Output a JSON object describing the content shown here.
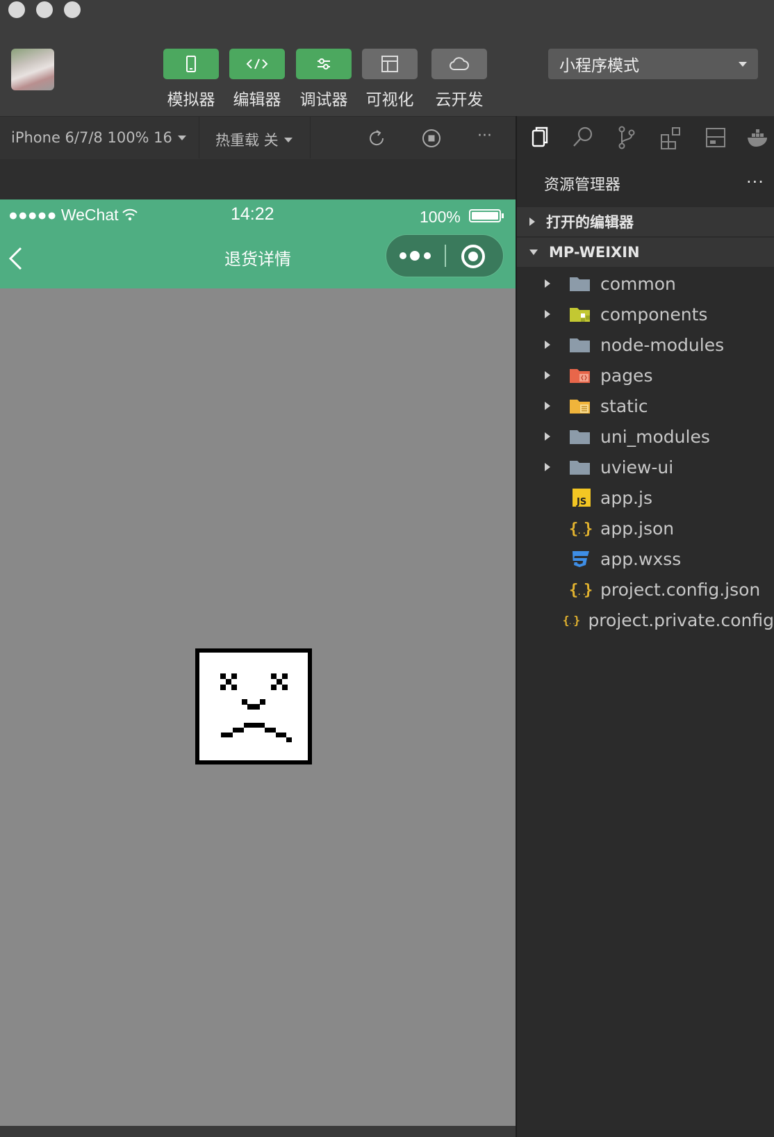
{
  "toolbar": {
    "buttons": [
      {
        "label": "模拟器",
        "icon": "phone-icon"
      },
      {
        "label": "编辑器",
        "icon": "code-icon"
      },
      {
        "label": "调试器",
        "icon": "sliders-icon"
      },
      {
        "label": "可视化",
        "icon": "layout-icon"
      },
      {
        "label": "云开发",
        "icon": "cloud-icon"
      }
    ],
    "mode_select": "小程序模式"
  },
  "simulator": {
    "device": "iPhone 6/7/8 100% 16",
    "hot_reload": "热重载 关",
    "more": "···"
  },
  "phone": {
    "carrier": "●●●●● WeChat",
    "time": "14:22",
    "battery": "100%",
    "nav_title": "退货详情"
  },
  "explorer": {
    "title": "资源管理器",
    "more": "···",
    "sections": {
      "open_editors": "打开的编辑器",
      "project": "MP-WEIXIN"
    },
    "items": [
      {
        "name": "common",
        "folder": true,
        "icon": "folder-icon"
      },
      {
        "name": "components",
        "folder": true,
        "icon": "components-folder-icon"
      },
      {
        "name": "node-modules",
        "folder": true,
        "icon": "folder-icon"
      },
      {
        "name": "pages",
        "folder": true,
        "icon": "pages-folder-icon"
      },
      {
        "name": "static",
        "folder": true,
        "icon": "static-folder-icon"
      },
      {
        "name": "uni_modules",
        "folder": true,
        "icon": "folder-icon"
      },
      {
        "name": "uview-ui",
        "folder": true,
        "icon": "folder-icon"
      },
      {
        "name": "app.js",
        "folder": false,
        "icon": "js-file-icon"
      },
      {
        "name": "app.json",
        "folder": false,
        "icon": "json-file-icon"
      },
      {
        "name": "app.wxss",
        "folder": false,
        "icon": "css-file-icon"
      },
      {
        "name": "project.config.json",
        "folder": false,
        "icon": "json-file-icon"
      },
      {
        "name": "project.private.config",
        "folder": false,
        "icon": "json-file-icon"
      }
    ]
  },
  "colors": {
    "accent": "#4ca85f",
    "phone_header": "#4fae82",
    "page_bg": "#898989"
  }
}
